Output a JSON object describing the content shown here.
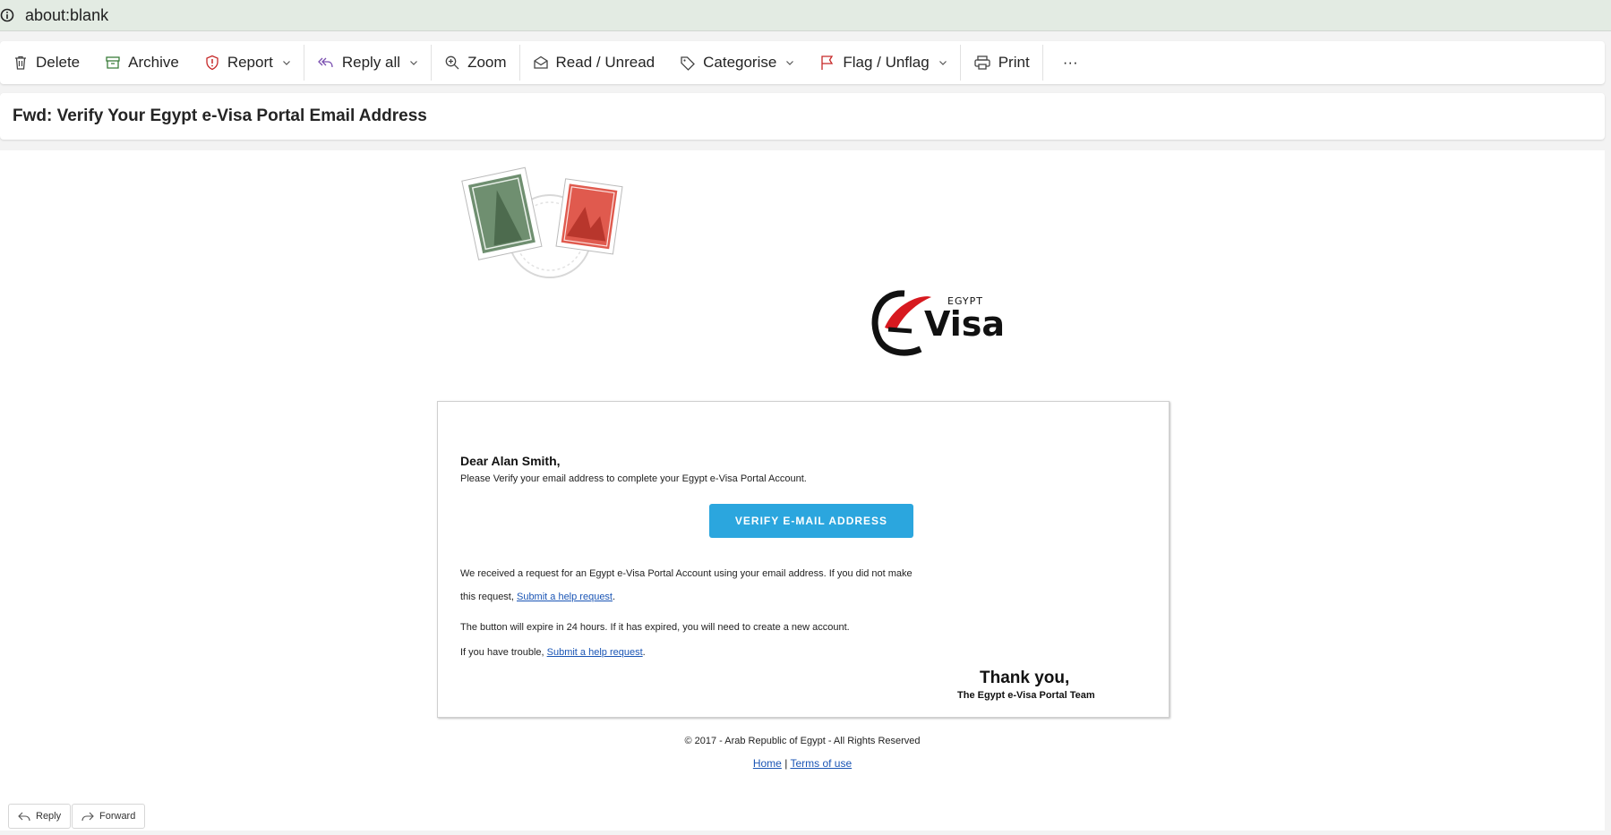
{
  "address_bar": {
    "url": "about:blank"
  },
  "toolbar": {
    "delete": "Delete",
    "archive": "Archive",
    "report": "Report",
    "reply_all": "Reply all",
    "zoom": "Zoom",
    "read_unread": "Read / Unread",
    "categorise": "Categorise",
    "flag_unflag": "Flag / Unflag",
    "print": "Print",
    "more": "···"
  },
  "subject": "Fwd: Verify Your Egypt e-Visa Portal Email Address",
  "email": {
    "logo": {
      "small": "EGYPT",
      "big": "Visa"
    },
    "greeting": "Dear Alan Smith,",
    "intro": "Please Verify your email address to complete your Egypt e-Visa Portal Account.",
    "verify_button": "VERIFY E-MAIL ADDRESS",
    "para1_a": "We received a request for an Egypt e-Visa Portal Account using your email address. If you did not make",
    "para1_b": "this request,",
    "para1_link": "Submit a help request",
    "para2": "The button will expire in 24 hours. If it has expired, you will need to create a new account.",
    "para3": "If you have trouble,",
    "para3_link": "Submit a help request",
    "thanks": "Thank you,",
    "team": "The Egypt e-Visa Portal Team",
    "footer_copy": "© 2017 - Arab Republic of Egypt - All Rights Reserved",
    "footer_home": "Home",
    "footer_sep": "|",
    "footer_terms": "Terms of use"
  },
  "actions": {
    "reply": "Reply",
    "forward": "Forward"
  },
  "colors": {
    "accent_button": "#2ba6de",
    "link": "#1a55b5",
    "logo_red": "#d7191f"
  }
}
